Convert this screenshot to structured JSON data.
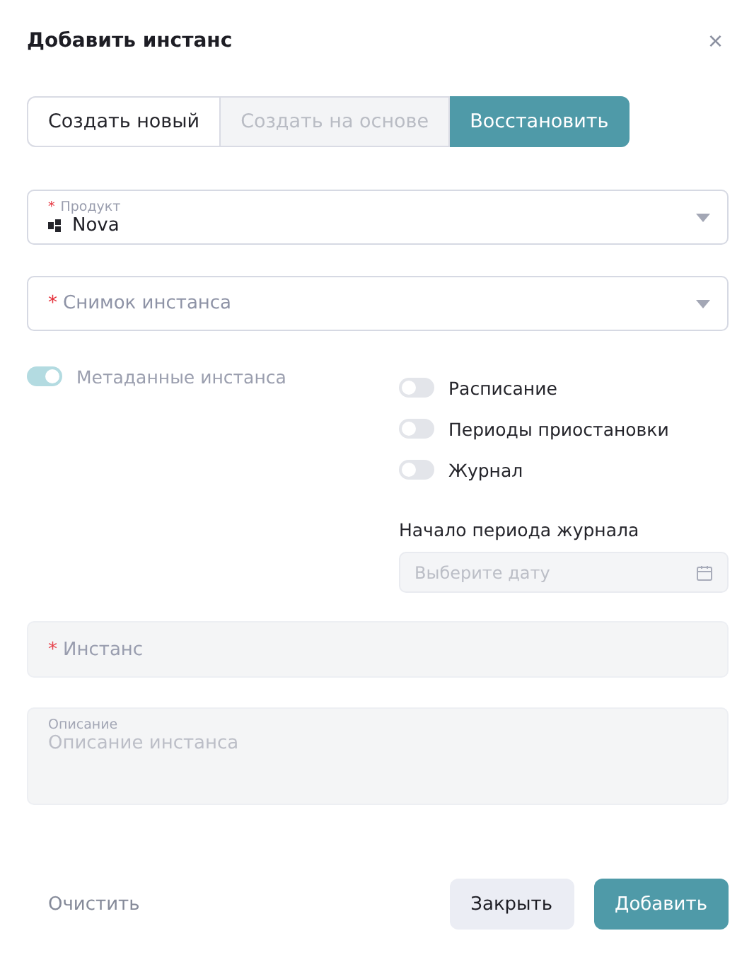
{
  "dialog": {
    "title": "Добавить инстанс",
    "close": "×"
  },
  "tabs": [
    {
      "label": "Создать новый",
      "selected": false,
      "disabled": false
    },
    {
      "label": "Создать на основе",
      "selected": false,
      "disabled": true
    },
    {
      "label": "Восстановить",
      "selected": true,
      "disabled": false
    }
  ],
  "product": {
    "label": "Продукт",
    "required_mark": "*",
    "value": "Nova"
  },
  "snapshot": {
    "placeholder": "Снимок инстанса",
    "required_mark": "*"
  },
  "metadata_toggle": {
    "label": "Метаданные инстанса",
    "on": true,
    "disabled": true
  },
  "toggles": [
    {
      "label": "Расписание",
      "on": false
    },
    {
      "label": "Периоды приостановки",
      "on": false
    },
    {
      "label": "Журнал",
      "on": false
    }
  ],
  "journal_start": {
    "label": "Начало периода журнала",
    "placeholder": "Выберите дату",
    "disabled": true
  },
  "instance": {
    "placeholder": "Инстанс",
    "required_mark": "*",
    "disabled": true
  },
  "description": {
    "label": "Описание",
    "placeholder": "Описание инстанса",
    "disabled": true
  },
  "footer": {
    "clear": "Очистить",
    "close": "Закрыть",
    "submit": "Добавить"
  }
}
